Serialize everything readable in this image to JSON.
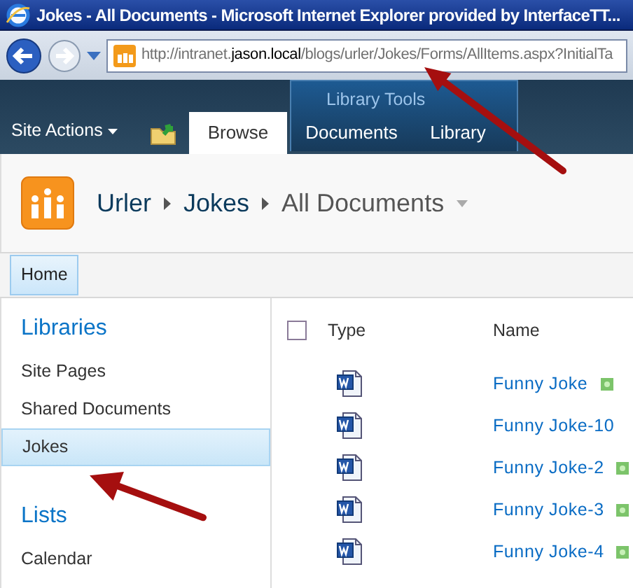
{
  "window": {
    "title": "Jokes - All Documents - Microsoft Internet Explorer provided by InterfaceTT..."
  },
  "address_bar": {
    "url_before": "http://intranet.",
    "url_host": "jason.local",
    "url_after": "/blogs/urler/Jokes/Forms/AllItems.aspx?InitialTa"
  },
  "ribbon": {
    "site_actions": "Site Actions",
    "group_label": "Library Tools",
    "tabs": [
      {
        "label": "Browse",
        "selected": true
      },
      {
        "label": "Documents",
        "selected": false
      },
      {
        "label": "Library",
        "selected": false
      }
    ]
  },
  "breadcrumb": [
    "Urler",
    "Jokes",
    "All Documents"
  ],
  "top_nav": [
    {
      "label": "Home",
      "selected": true
    }
  ],
  "quick_launch": [
    {
      "heading": "Libraries",
      "items": [
        {
          "label": "Site Pages",
          "selected": false
        },
        {
          "label": "Shared Documents",
          "selected": false
        },
        {
          "label": "Jokes",
          "selected": true
        }
      ]
    },
    {
      "heading": "Lists",
      "items": [
        {
          "label": "Calendar",
          "selected": false
        }
      ]
    }
  ],
  "table": {
    "select_all_checked": false,
    "columns": [
      "Type",
      "Name"
    ],
    "rows": [
      {
        "name": "Funny Joke",
        "new": true
      },
      {
        "name": "Funny Joke-10",
        "new": false
      },
      {
        "name": "Funny Joke-2",
        "new": true
      },
      {
        "name": "Funny Joke-3",
        "new": true
      },
      {
        "name": "Funny Joke-4",
        "new": true
      }
    ]
  },
  "annotations": [
    {
      "kind": "arrow"
    },
    {
      "kind": "arrow"
    }
  ]
}
